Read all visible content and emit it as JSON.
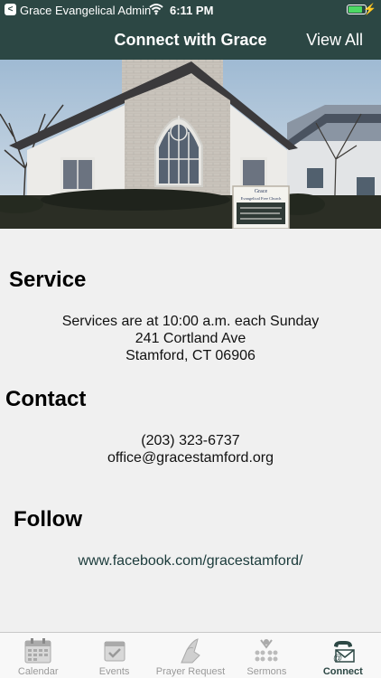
{
  "status_bar": {
    "back_glyph": "<",
    "carrier": "Grace Evangelical Admin",
    "time": "6:11 PM",
    "battery_level": 0.85
  },
  "nav": {
    "title": "Connect with Grace",
    "view_all": "View All"
  },
  "hero": {
    "sign_line1": "Grace",
    "sign_line2": "Evangelical Free Church"
  },
  "service": {
    "heading": "Service",
    "line1": "Services are at 10:00 a.m. each Sunday",
    "line2": "241 Cortland Ave",
    "line3": "Stamford, CT 06906"
  },
  "contact": {
    "heading": "Contact",
    "phone": "(203) 323-6737",
    "email": "office@gracestamford.org"
  },
  "follow": {
    "heading": "Follow",
    "facebook": "www.facebook.com/gracestamford/"
  },
  "tabs": [
    {
      "label": "Calendar",
      "icon": "calendar-icon",
      "active": false
    },
    {
      "label": "Events",
      "icon": "events-icon",
      "active": false
    },
    {
      "label": "Prayer Request",
      "icon": "praying-hands-icon",
      "active": false
    },
    {
      "label": "Sermons",
      "icon": "sermons-icon",
      "active": false
    },
    {
      "label": "Connect",
      "icon": "phone-mail-icon",
      "active": true
    }
  ],
  "colors": {
    "header_bg": "#2c4744",
    "page_bg": "#f0f0f0",
    "tab_active": "#2c4744",
    "tab_inactive": "#999999"
  }
}
